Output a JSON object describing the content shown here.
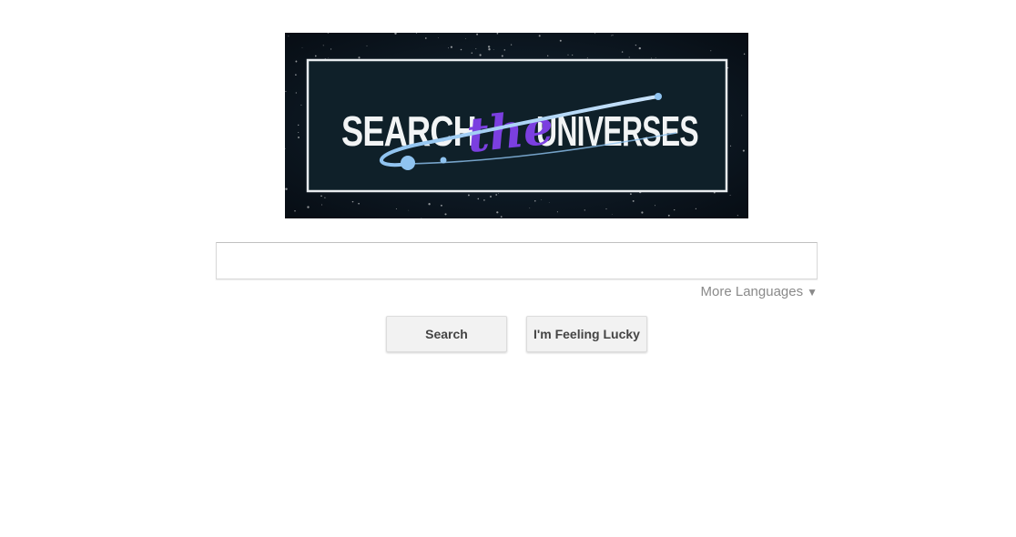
{
  "logo": {
    "text_left": "SEARCH",
    "text_mid": "the",
    "text_right": "UNIVERSES",
    "colors": {
      "background": "#0d1a24",
      "frame": "#e8ecef",
      "text": "#f2f4f5",
      "script": "#7b3fe0",
      "orbit": "#8fc3f0"
    }
  },
  "search": {
    "value": "",
    "placeholder": ""
  },
  "languages": {
    "label": "More Languages",
    "arrow": "▼"
  },
  "buttons": {
    "search_label": "Search",
    "lucky_label": "I'm Feeling Lucky"
  }
}
